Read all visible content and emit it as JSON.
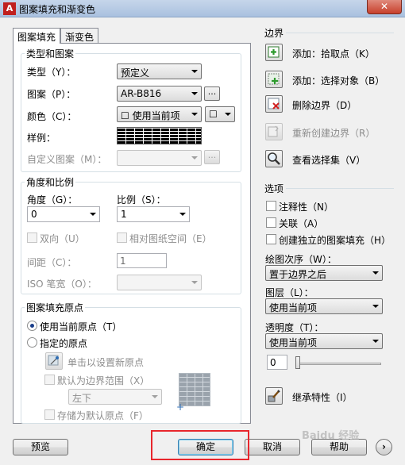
{
  "window": {
    "title": "图案填充和渐变色",
    "close": "✕"
  },
  "tabs": [
    {
      "label": "图案填充"
    },
    {
      "label": "渐变色"
    }
  ],
  "type_pattern": {
    "group_title": "类型和图案",
    "type_label": "类型（Y）：",
    "type_value": "预定义",
    "pattern_label": "图案（P）：",
    "pattern_value": "AR-B816",
    "browse": "...",
    "color_label": "颜色（C）：",
    "color_value": "☐ 使用当前项",
    "color2": "☐",
    "sample_label": "样例：",
    "custom_label": "自定义图案（M）：",
    "custom_browse": "..."
  },
  "angle_scale": {
    "group_title": "角度和比例",
    "angle_label": "角度（G）：",
    "angle_value": "0",
    "scale_label": "比例（S）：",
    "scale_value": "1",
    "double_label": "双向（U）",
    "relative_label": "相对图纸空间（E）",
    "spacing_label": "间距（C）：",
    "spacing_value": "1",
    "iso_label": "ISO 笔宽（O）："
  },
  "origin": {
    "group_title": "图案填充原点",
    "use_current": "使用当前原点（T）",
    "specified": "指定的原点",
    "click_set": "单击以设置新原点",
    "default_extents": "默认为边界范围（X）",
    "extent_value": "左下",
    "store_default": "存储为默认原点（F）"
  },
  "boundaries": {
    "title": "边界",
    "add_pick": "添加：拾取点（K）",
    "add_select": "添加：选择对象（B）",
    "remove": "删除边界（D）",
    "recreate": "重新创建边界（R）",
    "view_sel": "查看选择集（V）"
  },
  "options": {
    "title": "选项",
    "annotative": "注释性（N）",
    "associative": "关联（A）",
    "separate": "创建独立的图案填充（H）",
    "draw_order_label": "绘图次序（W）：",
    "draw_order_value": "置于边界之后",
    "layer_label": "图层（L）：",
    "layer_value": "使用当前项",
    "transparency_label": "透明度（T）：",
    "transparency_value": "使用当前项",
    "transparency_amount": "0"
  },
  "inherit": "继承特性（I）",
  "footer": {
    "preview": "预览",
    "ok": "确定",
    "cancel": "取消",
    "help": "帮助",
    "more": "›"
  },
  "watermark": "Baidu 经验"
}
